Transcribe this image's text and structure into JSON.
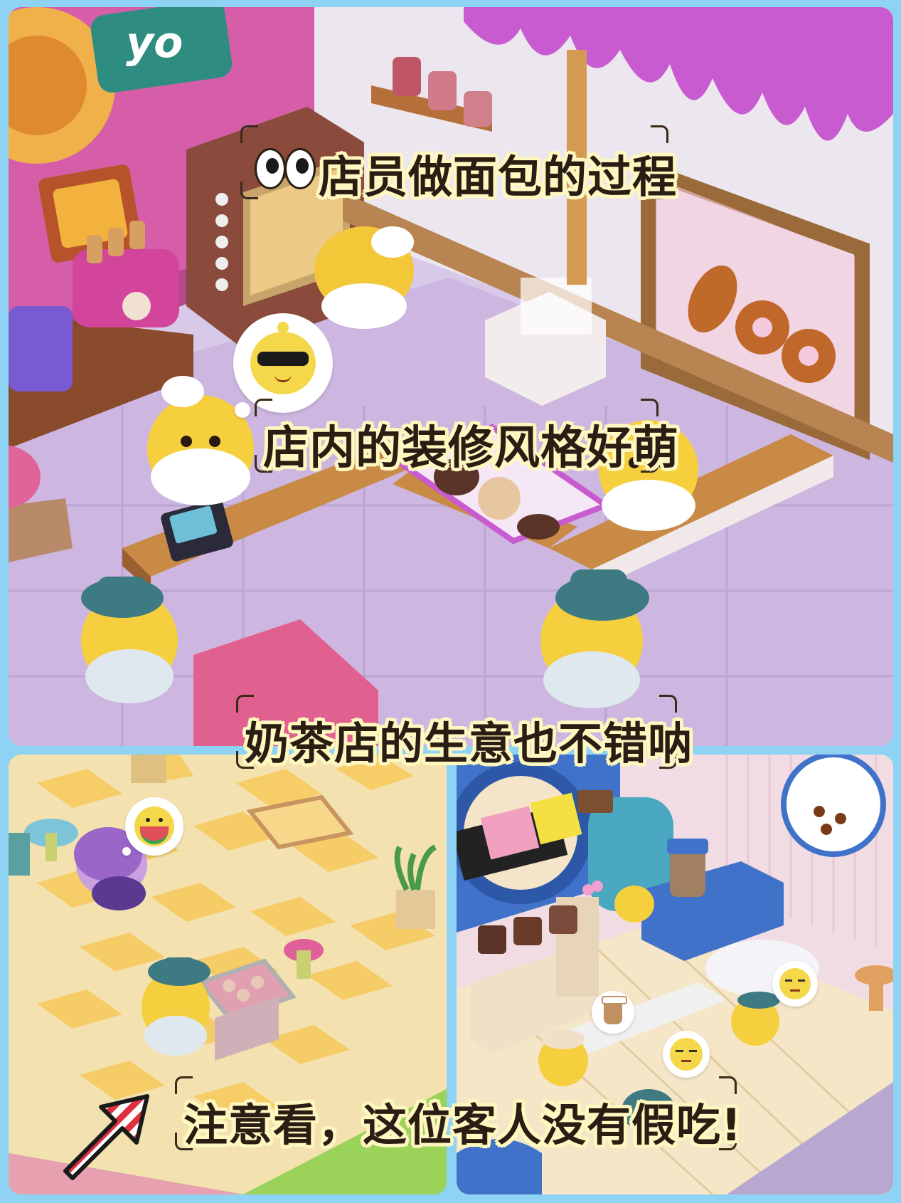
{
  "captions": {
    "top_1": "店员做面包的过程",
    "top_2": "店内的装修风格好萌",
    "middle": "奶茶店的生意也不错呐",
    "bottom": "注意看，这位客人没有假吃!"
  },
  "signs": {
    "top_left_sign": "yo"
  },
  "icons": {
    "eyes": "eyes-icon",
    "arrow": "striped-arrow-icon",
    "sunglasses": "sunglasses-face-icon",
    "watermelon": "watermelon-chick-icon",
    "milk_tea": "milk-tea-icon",
    "sleepy": "sleepy-face-icon"
  },
  "colors": {
    "background": "#8fd3f4",
    "caption_text": "#2a1e14",
    "caption_outline": "#fff7c0",
    "awning": "#c85bd0"
  }
}
